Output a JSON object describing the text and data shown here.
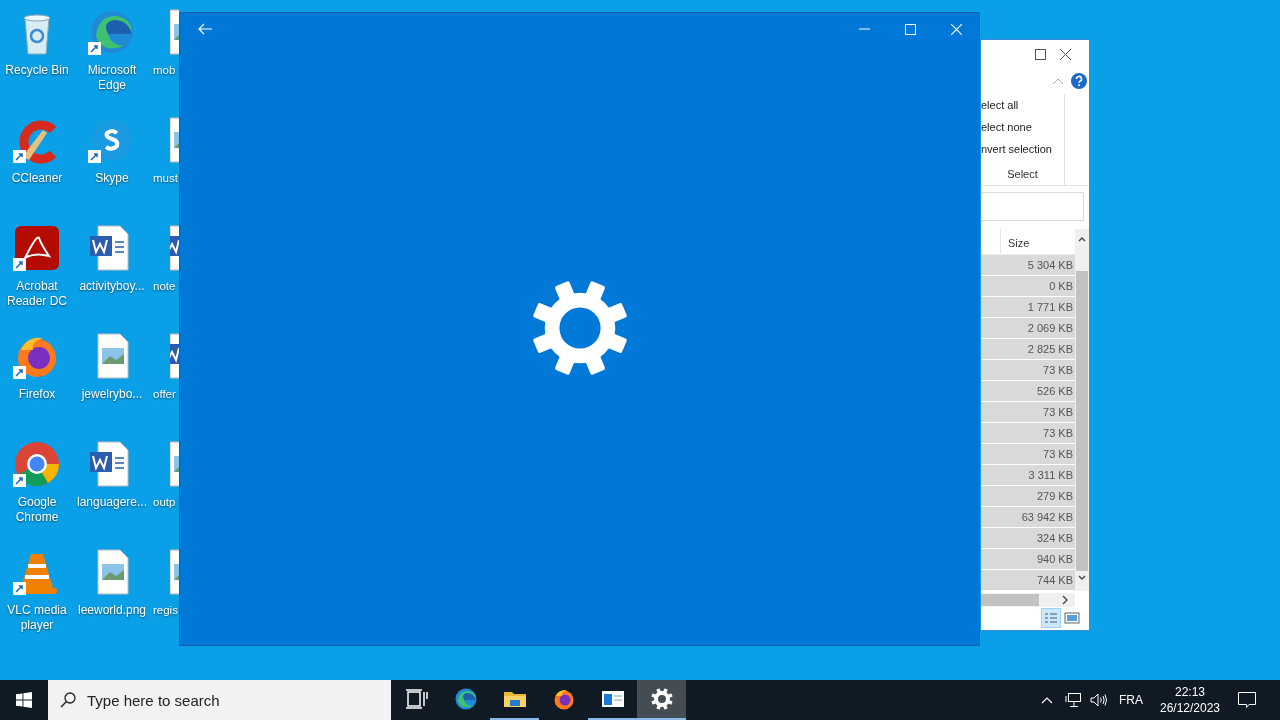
{
  "desktop_icons": [
    {
      "label": "Recycle Bin",
      "kind": "recycle",
      "shortcut": false
    },
    {
      "label": "CCleaner",
      "kind": "ccleaner",
      "shortcut": true
    },
    {
      "label": "Acrobat Reader DC",
      "kind": "acrobat",
      "shortcut": true
    },
    {
      "label": "Firefox",
      "kind": "firefox",
      "shortcut": true
    },
    {
      "label": "Google Chrome",
      "kind": "chrome",
      "shortcut": true
    },
    {
      "label": "VLC media player",
      "kind": "vlc",
      "shortcut": true
    },
    {
      "label": "Microsoft Edge",
      "kind": "edge",
      "shortcut": true
    },
    {
      "label": "Skype",
      "kind": "skype",
      "shortcut": true
    },
    {
      "label": "activityboy...",
      "kind": "word",
      "shortcut": false
    },
    {
      "label": "jewelrybo...",
      "kind": "image",
      "shortcut": false
    },
    {
      "label": "languagere...",
      "kind": "word",
      "shortcut": false
    },
    {
      "label": "leeworld.png",
      "kind": "image",
      "shortcut": false
    },
    {
      "label": "mob",
      "kind": "image",
      "shortcut": false
    },
    {
      "label": "must",
      "kind": "image",
      "shortcut": false
    },
    {
      "label": "note",
      "kind": "word",
      "shortcut": false
    },
    {
      "label": "offer",
      "kind": "word",
      "shortcut": false
    },
    {
      "label": "outp",
      "kind": "image",
      "shortcut": false
    },
    {
      "label": "regis",
      "kind": "image",
      "shortcut": false
    }
  ],
  "explorer": {
    "ribbon_items": [
      "elect all",
      "elect none",
      "nvert selection"
    ],
    "group_label": "Select",
    "column": "Size",
    "rows": [
      "5 304 KB",
      "0 KB",
      "1 771 KB",
      "2 069 KB",
      "2 825 KB",
      "73 KB",
      "526 KB",
      "73 KB",
      "73 KB",
      "73 KB",
      "3 311 KB",
      "279 KB",
      "63 942 KB",
      "324 KB",
      "940 KB",
      "744 KB"
    ]
  },
  "taskbar": {
    "search": {
      "placeholder": "Type here to search"
    },
    "apps": [
      {
        "kind": "taskview",
        "running": false,
        "selected": false
      },
      {
        "kind": "edge",
        "running": false,
        "selected": false
      },
      {
        "kind": "folder",
        "running": true,
        "selected": false
      },
      {
        "kind": "firefox",
        "running": false,
        "selected": false
      },
      {
        "kind": "window",
        "running": true,
        "selected": false
      },
      {
        "kind": "gear",
        "running": true,
        "selected": true
      }
    ],
    "language": "FRA",
    "time": "22:13",
    "date": "26/12/2023"
  }
}
